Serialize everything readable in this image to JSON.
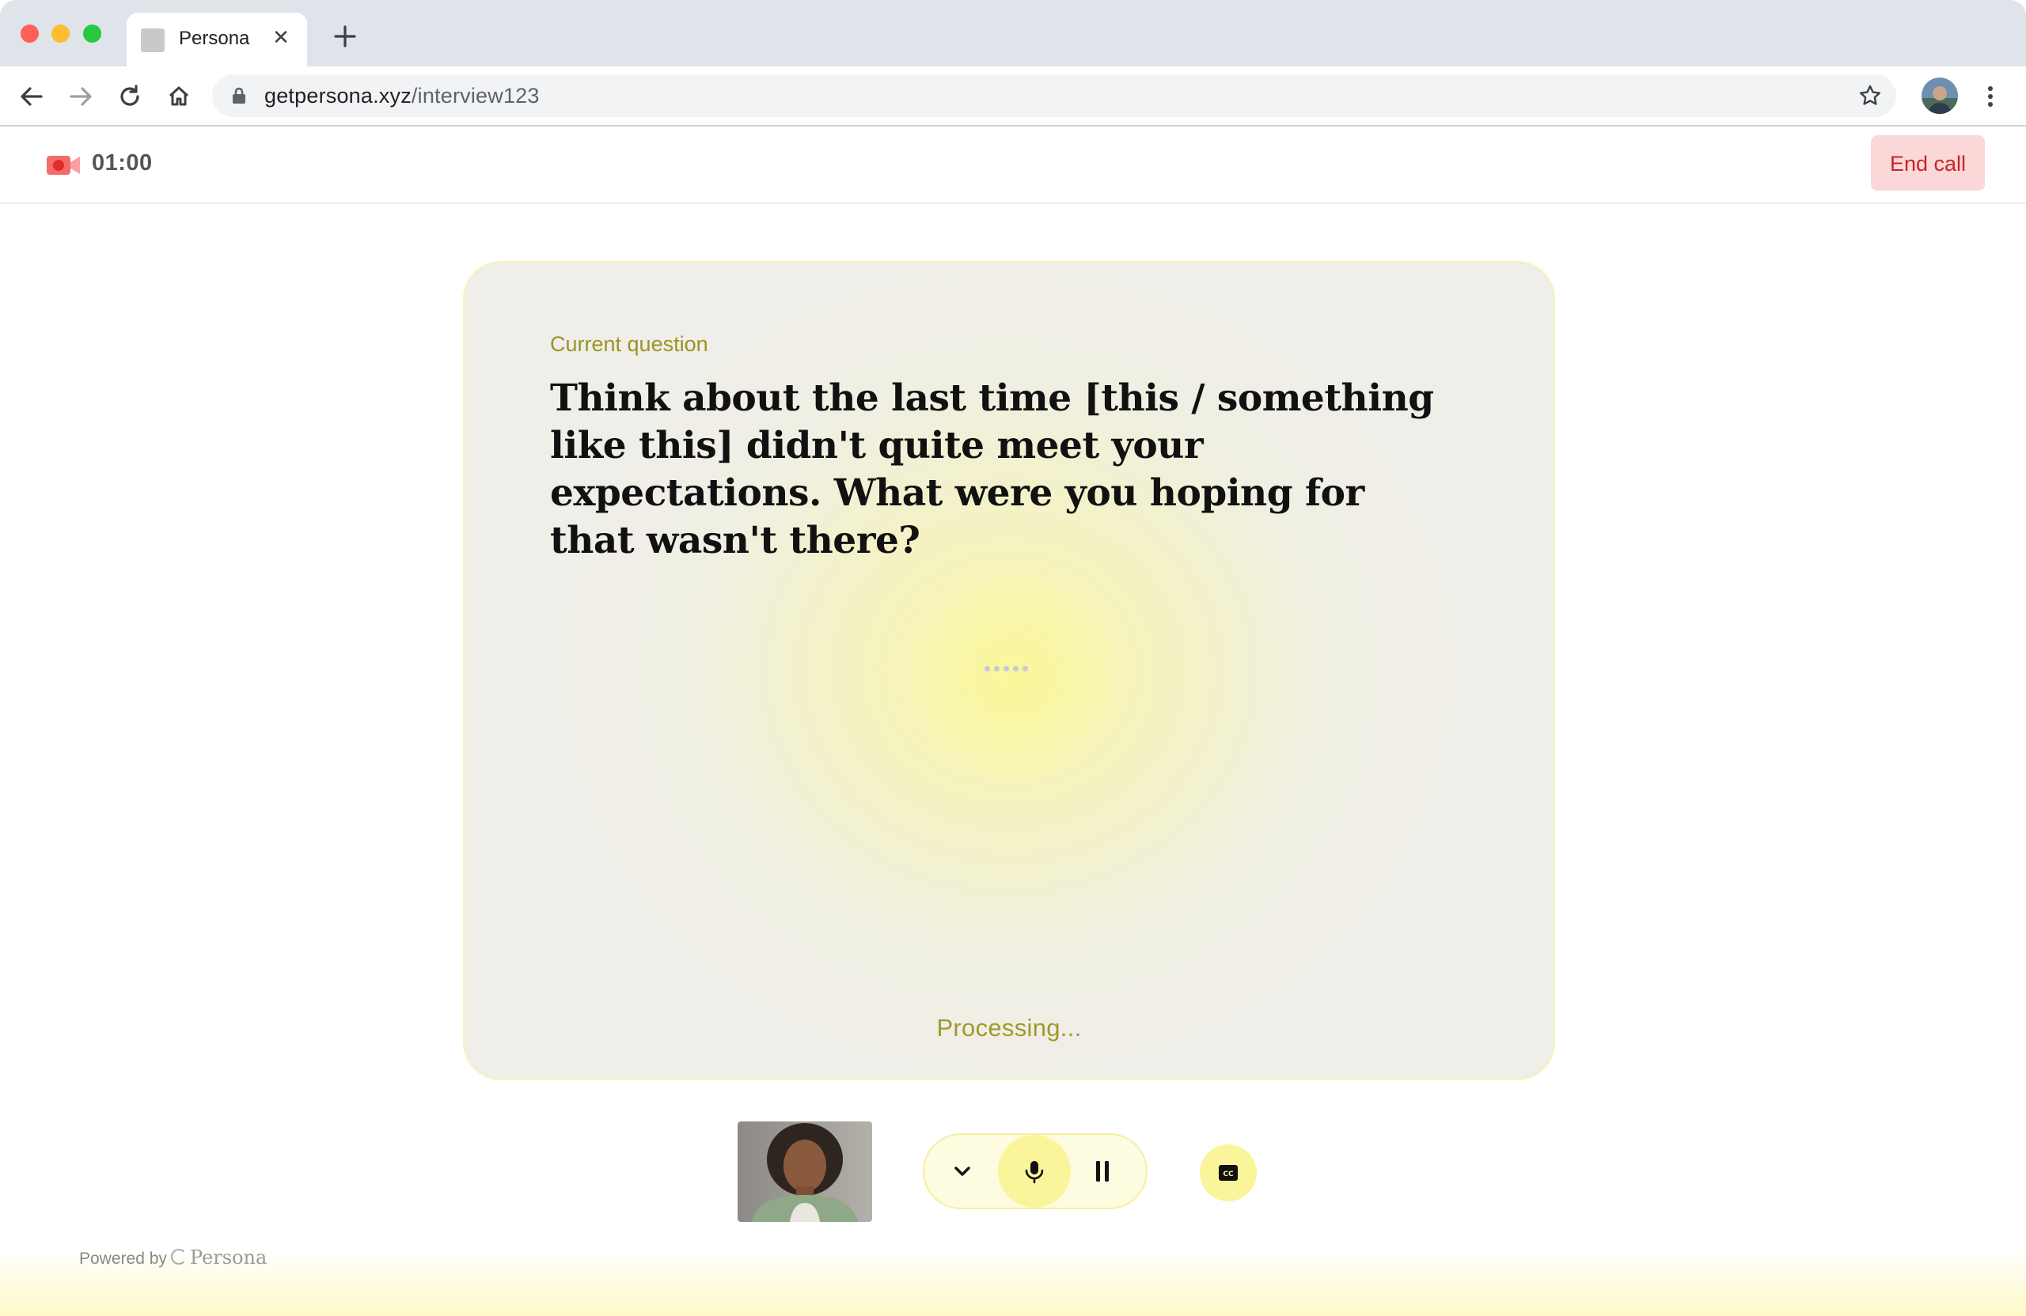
{
  "browser": {
    "tab_title": "Persona",
    "url_domain": "getpersona.xyz",
    "url_path": "/interview123"
  },
  "header": {
    "timer": "01:00",
    "end_call_label": "End call"
  },
  "question": {
    "label": "Current question",
    "text": "Think about the last time [this / something like this] didn't quite meet your expectations. What were you hoping for that wasn't there?",
    "status": "Processing..."
  },
  "footer": {
    "powered_by": "Powered by",
    "brand": "Persona"
  },
  "colors": {
    "accent_yellow": "#faf59a",
    "end_call_bg": "#fcd7d7",
    "end_call_text": "#c0262d",
    "label_olive": "#9a9424",
    "record_red": "#f04b4b"
  },
  "icons": {
    "record": "video-record-icon",
    "chevron": "chevron-down-icon",
    "mic": "microphone-icon",
    "pause": "pause-icon",
    "captions": "closed-captions-icon"
  }
}
